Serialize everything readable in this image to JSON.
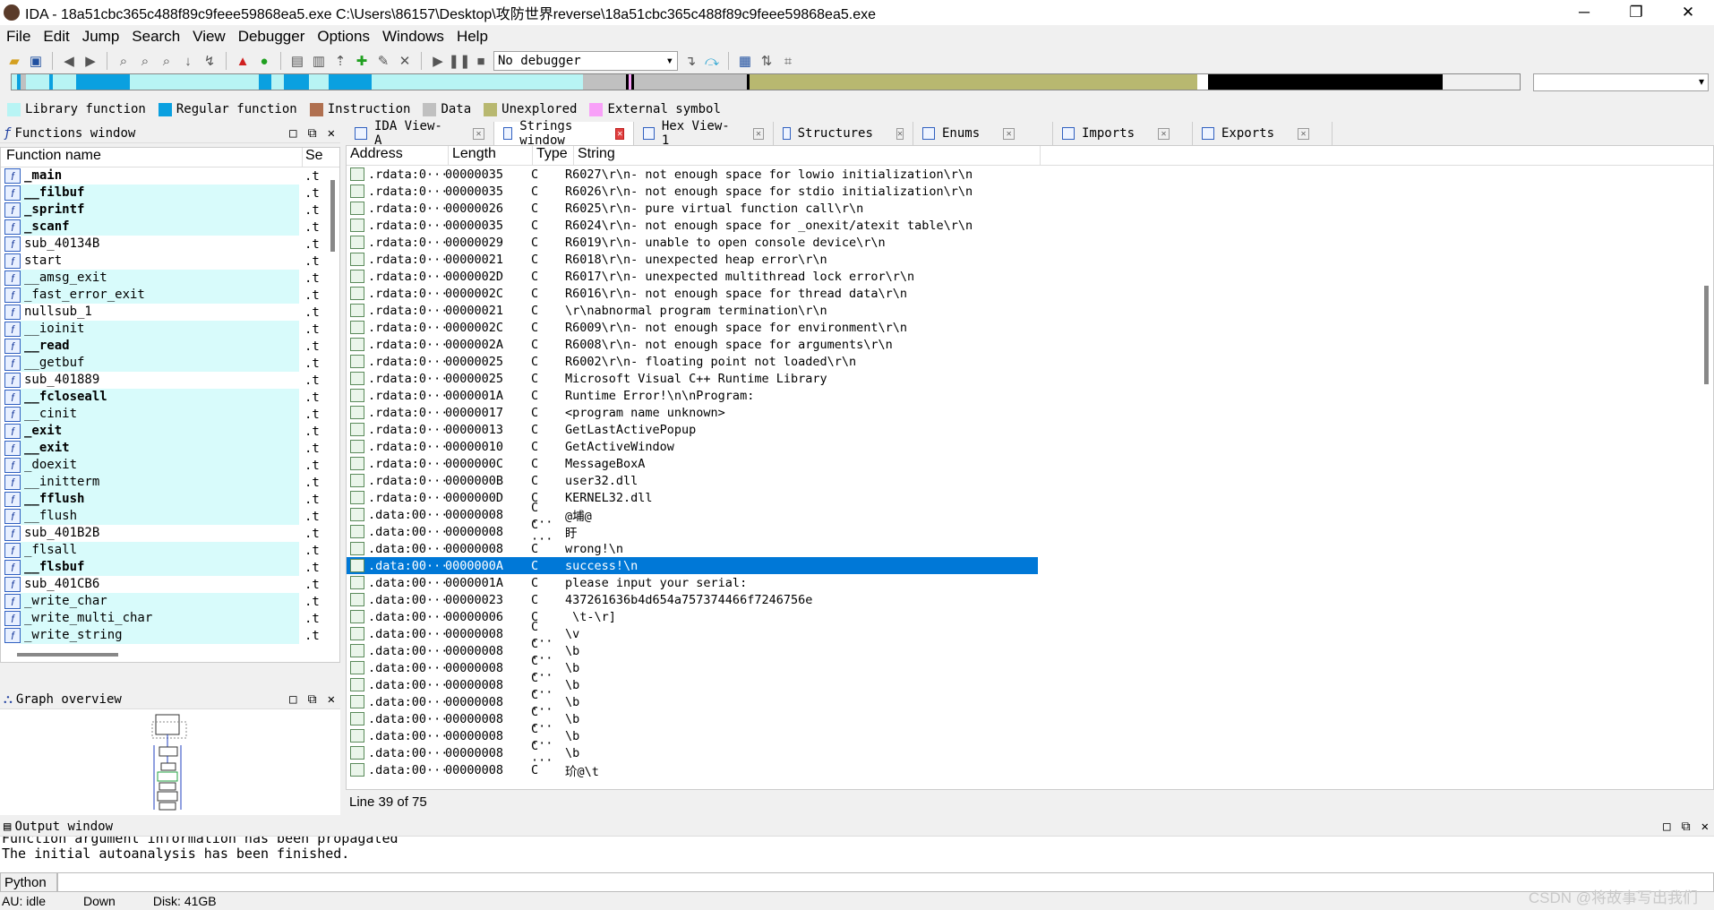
{
  "window": {
    "title": "IDA - 18a51cbc365c488f89c9feee59868ea5.exe C:\\Users\\86157\\Desktop\\攻防世界reverse\\18a51cbc365c488f89c9feee59868ea5.exe",
    "minimize": "─",
    "maximize": "❐",
    "close": "✕"
  },
  "menu": [
    "File",
    "Edit",
    "Jump",
    "Search",
    "View",
    "Debugger",
    "Options",
    "Windows",
    "Help"
  ],
  "toolbar": {
    "debugger_select": "No debugger"
  },
  "legend": [
    {
      "label": "Library function",
      "color": "#b8f4f4"
    },
    {
      "label": "Regular function",
      "color": "#0aa0e0"
    },
    {
      "label": "Instruction",
      "color": "#b07050"
    },
    {
      "label": "Data",
      "color": "#c0c0c0"
    },
    {
      "label": "Unexplored",
      "color": "#b8b870"
    },
    {
      "label": "External symbol",
      "color": "#f8a0f8"
    }
  ],
  "functions_window": {
    "title": "Functions window",
    "col_name": "Function name",
    "col_seg": "Se",
    "rows": [
      {
        "name": "_main",
        "seg": ".t",
        "bold": true,
        "lib": false
      },
      {
        "name": "__filbuf",
        "seg": ".t",
        "bold": true,
        "lib": true
      },
      {
        "name": "_sprintf",
        "seg": ".t",
        "bold": true,
        "lib": true
      },
      {
        "name": "_scanf",
        "seg": ".t",
        "bold": true,
        "lib": true
      },
      {
        "name": "sub_40134B",
        "seg": ".t",
        "bold": false,
        "lib": false
      },
      {
        "name": "start",
        "seg": ".t",
        "bold": false,
        "lib": false
      },
      {
        "name": "__amsg_exit",
        "seg": ".t",
        "bold": false,
        "lib": true
      },
      {
        "name": "_fast_error_exit",
        "seg": ".t",
        "bold": false,
        "lib": true
      },
      {
        "name": "nullsub_1",
        "seg": ".t",
        "bold": false,
        "lib": false
      },
      {
        "name": "__ioinit",
        "seg": ".t",
        "bold": false,
        "lib": true
      },
      {
        "name": "__read",
        "seg": ".t",
        "bold": true,
        "lib": true
      },
      {
        "name": "__getbuf",
        "seg": ".t",
        "bold": false,
        "lib": true
      },
      {
        "name": "sub_401889",
        "seg": ".t",
        "bold": false,
        "lib": false
      },
      {
        "name": "__fcloseall",
        "seg": ".t",
        "bold": true,
        "lib": true
      },
      {
        "name": "__cinit",
        "seg": ".t",
        "bold": false,
        "lib": true
      },
      {
        "name": "_exit",
        "seg": ".t",
        "bold": true,
        "lib": true
      },
      {
        "name": "__exit",
        "seg": ".t",
        "bold": true,
        "lib": true
      },
      {
        "name": "_doexit",
        "seg": ".t",
        "bold": false,
        "lib": true
      },
      {
        "name": "__initterm",
        "seg": ".t",
        "bold": false,
        "lib": true
      },
      {
        "name": "__fflush",
        "seg": ".t",
        "bold": true,
        "lib": true
      },
      {
        "name": "__flush",
        "seg": ".t",
        "bold": false,
        "lib": true
      },
      {
        "name": "sub_401B2B",
        "seg": ".t",
        "bold": false,
        "lib": false
      },
      {
        "name": "_flsall",
        "seg": ".t",
        "bold": false,
        "lib": true
      },
      {
        "name": "__flsbuf",
        "seg": ".t",
        "bold": true,
        "lib": true
      },
      {
        "name": "sub_401CB6",
        "seg": ".t",
        "bold": false,
        "lib": false
      },
      {
        "name": "_write_char",
        "seg": ".t",
        "bold": false,
        "lib": true
      },
      {
        "name": "_write_multi_char",
        "seg": ".t",
        "bold": false,
        "lib": true
      },
      {
        "name": "_write_string",
        "seg": ".t",
        "bold": false,
        "lib": true
      }
    ]
  },
  "graph_overview": {
    "title": "Graph overview"
  },
  "tabs": [
    {
      "label": "IDA View-A",
      "active": false,
      "red": false
    },
    {
      "label": "Strings window",
      "active": true,
      "red": true
    },
    {
      "label": "Hex View-1",
      "active": false,
      "red": false
    },
    {
      "label": "Structures",
      "active": false,
      "red": false
    },
    {
      "label": "Enums",
      "active": false,
      "red": false
    },
    {
      "label": "Imports",
      "active": false,
      "red": false
    },
    {
      "label": "Exports",
      "active": false,
      "red": false
    }
  ],
  "strings_window": {
    "col_address": "Address",
    "col_length": "Length",
    "col_type": "Type",
    "col_string": "String",
    "selected_index": 23,
    "rows": [
      {
        "addr": ".rdata:0···",
        "len": "00000035",
        "type": "C",
        "str": "R6027\\r\\n- not enough space for lowio initialization\\r\\n"
      },
      {
        "addr": ".rdata:0···",
        "len": "00000035",
        "type": "C",
        "str": "R6026\\r\\n- not enough space for stdio initialization\\r\\n"
      },
      {
        "addr": ".rdata:0···",
        "len": "00000026",
        "type": "C",
        "str": "R6025\\r\\n- pure virtual function call\\r\\n"
      },
      {
        "addr": ".rdata:0···",
        "len": "00000035",
        "type": "C",
        "str": "R6024\\r\\n- not enough space for _onexit/atexit table\\r\\n"
      },
      {
        "addr": ".rdata:0···",
        "len": "00000029",
        "type": "C",
        "str": "R6019\\r\\n- unable to open console device\\r\\n"
      },
      {
        "addr": ".rdata:0···",
        "len": "00000021",
        "type": "C",
        "str": "R6018\\r\\n- unexpected heap error\\r\\n"
      },
      {
        "addr": ".rdata:0···",
        "len": "0000002D",
        "type": "C",
        "str": "R6017\\r\\n- unexpected multithread lock error\\r\\n"
      },
      {
        "addr": ".rdata:0···",
        "len": "0000002C",
        "type": "C",
        "str": "R6016\\r\\n- not enough space for thread data\\r\\n"
      },
      {
        "addr": ".rdata:0···",
        "len": "00000021",
        "type": "C",
        "str": "\\r\\nabnormal program termination\\r\\n"
      },
      {
        "addr": ".rdata:0···",
        "len": "0000002C",
        "type": "C",
        "str": "R6009\\r\\n- not enough space for environment\\r\\n"
      },
      {
        "addr": ".rdata:0···",
        "len": "0000002A",
        "type": "C",
        "str": "R6008\\r\\n- not enough space for arguments\\r\\n"
      },
      {
        "addr": ".rdata:0···",
        "len": "00000025",
        "type": "C",
        "str": "R6002\\r\\n- floating point not loaded\\r\\n"
      },
      {
        "addr": ".rdata:0···",
        "len": "00000025",
        "type": "C",
        "str": "Microsoft Visual C++ Runtime Library"
      },
      {
        "addr": ".rdata:0···",
        "len": "0000001A",
        "type": "C",
        "str": "Runtime Error!\\n\\nProgram: "
      },
      {
        "addr": ".rdata:0···",
        "len": "00000017",
        "type": "C",
        "str": "<program name unknown>"
      },
      {
        "addr": ".rdata:0···",
        "len": "00000013",
        "type": "C",
        "str": "GetLastActivePopup"
      },
      {
        "addr": ".rdata:0···",
        "len": "00000010",
        "type": "C",
        "str": "GetActiveWindow"
      },
      {
        "addr": ".rdata:0···",
        "len": "0000000C",
        "type": "C",
        "str": "MessageBoxA"
      },
      {
        "addr": ".rdata:0···",
        "len": "0000000B",
        "type": "C",
        "str": "user32.dll"
      },
      {
        "addr": ".rdata:0···",
        "len": "0000000D",
        "type": "C",
        "str": "KERNEL32.dll"
      },
      {
        "addr": ".data:00···",
        "len": "00000008",
        "type": "C ···",
        "str": "@埔@"
      },
      {
        "addr": ".data:00···",
        "len": "00000008",
        "type": "C ···",
        "str": "盱"
      },
      {
        "addr": ".data:00···",
        "len": "00000008",
        "type": "C",
        "str": "wrong!\\n"
      },
      {
        "addr": ".data:00···",
        "len": "0000000A",
        "type": "C",
        "str": "success!\\n"
      },
      {
        "addr": ".data:00···",
        "len": "0000001A",
        "type": "C",
        "str": "please input your serial:"
      },
      {
        "addr": ".data:00···",
        "len": "00000023",
        "type": "C",
        "str": "437261636b4d654a757374466f7246756e"
      },
      {
        "addr": ".data:00···",
        "len": "00000006",
        "type": "C",
        "str": " \\t-\\r]"
      },
      {
        "addr": ".data:00···",
        "len": "00000008",
        "type": "C ···",
        "str": "\\v"
      },
      {
        "addr": ".data:00···",
        "len": "00000008",
        "type": "C ···",
        "str": "\\b"
      },
      {
        "addr": ".data:00···",
        "len": "00000008",
        "type": "C ···",
        "str": "\\b"
      },
      {
        "addr": ".data:00···",
        "len": "00000008",
        "type": "C ···",
        "str": "\\b"
      },
      {
        "addr": ".data:00···",
        "len": "00000008",
        "type": "C ···",
        "str": "\\b"
      },
      {
        "addr": ".data:00···",
        "len": "00000008",
        "type": "C ···",
        "str": "\\b"
      },
      {
        "addr": ".data:00···",
        "len": "00000008",
        "type": "C ···",
        "str": "\\b"
      },
      {
        "addr": ".data:00···",
        "len": "00000008",
        "type": "C ···",
        "str": "\\b"
      },
      {
        "addr": ".data:00···",
        "len": "00000008",
        "type": "C",
        "str": "玠@\\t"
      }
    ],
    "status": "Line 39 of 75"
  },
  "output_window": {
    "title": "Output window",
    "lines": [
      "Function argument information has been propagated",
      "The initial autoanalysis has been finished."
    ]
  },
  "python": {
    "label": "Python"
  },
  "statusbar": {
    "au": "AU:  idle",
    "down": "Down",
    "disk": "Disk: 41GB"
  },
  "watermark": "CSDN @将故事写出我们"
}
